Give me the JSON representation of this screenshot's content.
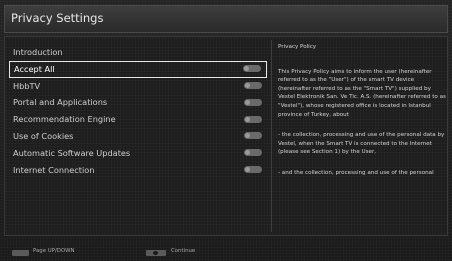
{
  "header": {
    "title": "Privacy Settings"
  },
  "menu": {
    "items": [
      {
        "label": "Introduction",
        "has_toggle": false,
        "selected": false
      },
      {
        "label": "Accept All",
        "has_toggle": true,
        "selected": true
      },
      {
        "label": "HbbTV",
        "has_toggle": true,
        "selected": false
      },
      {
        "label": "Portal and Applications",
        "has_toggle": true,
        "selected": false
      },
      {
        "label": "Recommendation Engine",
        "has_toggle": true,
        "selected": false
      },
      {
        "label": "Use of Cookies",
        "has_toggle": true,
        "selected": false
      },
      {
        "label": "Automatic Software Updates",
        "has_toggle": true,
        "selected": false
      },
      {
        "label": "Internet Connection",
        "has_toggle": true,
        "selected": false
      }
    ]
  },
  "policy": {
    "title": "Privacy Policy",
    "paragraphs": [
      "This Privacy Policy aims to inform the user (hereinafter referred to as the \"User\") of the smart TV device (hereinafter referred to as the \"Smart TV\") supplied by Vestel Elektronik San. Ve Tic. A.S. (hereinafter referred to as \"Vestel\"), whose registered office is located in Istanbul province of Turkey, about",
      "-   the collection, processing and use of the personal data by Vestel, when the Smart TV is connected to the Internet (please see Section 1) by the User,",
      "-   and the collection, processing and use of the personal"
    ]
  },
  "footer": {
    "hint_page": "Page UP/DOWN",
    "hint_continue": "Continue"
  },
  "colors": {
    "background": "#1e1e1e",
    "title_bar": "#333333",
    "selection_border": "#e6e6e6",
    "toggle": "#6a6a6a",
    "text": "#d8d8d8"
  }
}
